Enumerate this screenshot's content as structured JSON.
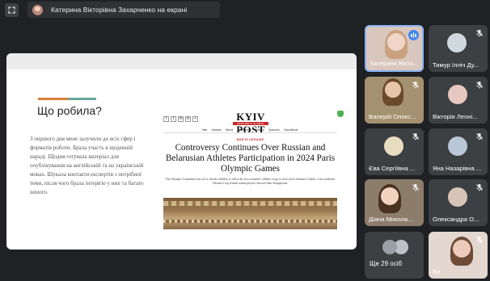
{
  "presenter": {
    "label": "Катерина Вікторівна Захарченко на екрані"
  },
  "slide": {
    "title": "Що робила?",
    "body": "З першого дня мене залучили до всіх сфер і форматів роботи. Брала участь в щоденній нараді. Щодня готувала матеріал для опублікування на англійській та на українській мовах. Шукала контакти експертів з потрібної теми, після чого брала інтерв'ю у них та багато іншого.",
    "article": {
      "masthead": "KYIV POST",
      "tagline": "UKRAINE'S GLOBAL VOICE",
      "nav": [
        "War",
        "Ukraine",
        "World",
        "Economics",
        "Videos",
        "Opinions",
        "Classifieds"
      ],
      "section": "WAR IN UKRAINE",
      "headline": "Controversy Continues Over Russian and Belarusian Athletes Participation in 2024 Paris Olympic Games",
      "lede": "The Olympic Committee has yet to decide whether to allow the two countries' athletes to go to next year's Summer Games. Last weekend, Ukraine's top female tennis players showed their disapproval."
    }
  },
  "participants": [
    {
      "name": "Катерина Вікто...",
      "speaking": true
    },
    {
      "name": "Тимур Ілліч Ду...",
      "speaking": false
    },
    {
      "name": "Валерій Олекс...",
      "speaking": false
    },
    {
      "name": "Вікторія Леоні...",
      "speaking": false
    },
    {
      "name": "Єва Сергіївна ...",
      "speaking": false
    },
    {
      "name": "Яна Назарівна ...",
      "speaking": false
    },
    {
      "name": "Діана Микола...",
      "speaking": false
    },
    {
      "name": "Олександра О...",
      "speaking": false
    },
    {
      "name": "Ще 29 осіб",
      "speaking": false
    },
    {
      "name": "Ви",
      "speaking": false
    }
  ],
  "colors": {
    "background": "#202124",
    "tile": "#3c4043",
    "active_border": "#8ab4f8",
    "speaking": "#4285f4"
  }
}
